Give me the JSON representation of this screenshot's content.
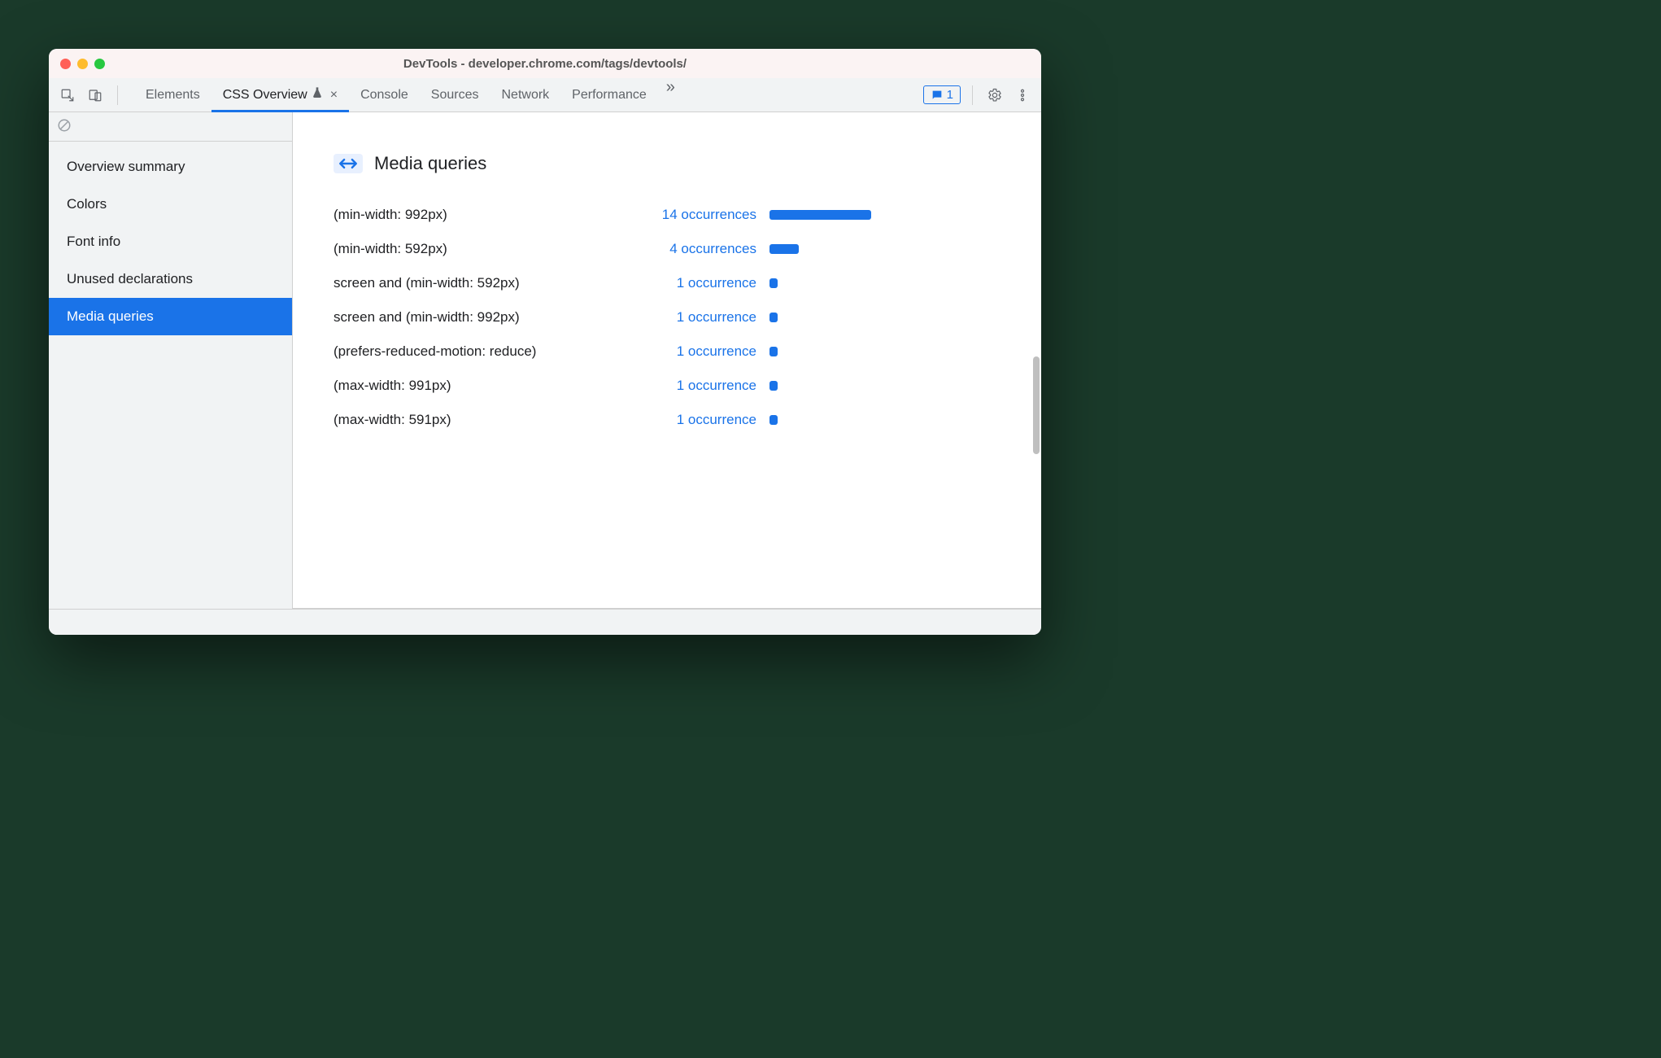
{
  "window": {
    "title": "DevTools - developer.chrome.com/tags/devtools/"
  },
  "toolbar": {
    "tabs": [
      {
        "label": "Elements"
      },
      {
        "label": "CSS Overview",
        "active": true,
        "experimental": true,
        "closeable": true
      },
      {
        "label": "Console"
      },
      {
        "label": "Sources"
      },
      {
        "label": "Network"
      },
      {
        "label": "Performance"
      }
    ],
    "issues_count": "1"
  },
  "sidebar": {
    "items": [
      {
        "label": "Overview summary"
      },
      {
        "label": "Colors"
      },
      {
        "label": "Font info"
      },
      {
        "label": "Unused declarations"
      },
      {
        "label": "Media queries",
        "selected": true
      }
    ]
  },
  "main": {
    "title": "Media queries",
    "rows": [
      {
        "query": "(min-width: 992px)",
        "count_label": "14 occurrences",
        "count": 14
      },
      {
        "query": "(min-width: 592px)",
        "count_label": "4 occurrences",
        "count": 4
      },
      {
        "query": "screen and (min-width: 592px)",
        "count_label": "1 occurrence",
        "count": 1
      },
      {
        "query": "screen and (min-width: 992px)",
        "count_label": "1 occurrence",
        "count": 1
      },
      {
        "query": "(prefers-reduced-motion: reduce)",
        "count_label": "1 occurrence",
        "count": 1
      },
      {
        "query": "(max-width: 991px)",
        "count_label": "1 occurrence",
        "count": 1
      },
      {
        "query": "(max-width: 591px)",
        "count_label": "1 occurrence",
        "count": 1
      }
    ]
  },
  "chart_data": {
    "type": "bar",
    "title": "Media queries",
    "categories": [
      "(min-width: 992px)",
      "(min-width: 592px)",
      "screen and (min-width: 592px)",
      "screen and (min-width: 992px)",
      "(prefers-reduced-motion: reduce)",
      "(max-width: 991px)",
      "(max-width: 591px)"
    ],
    "values": [
      14,
      4,
      1,
      1,
      1,
      1,
      1
    ],
    "xlabel": "occurrences",
    "ylabel": ""
  }
}
